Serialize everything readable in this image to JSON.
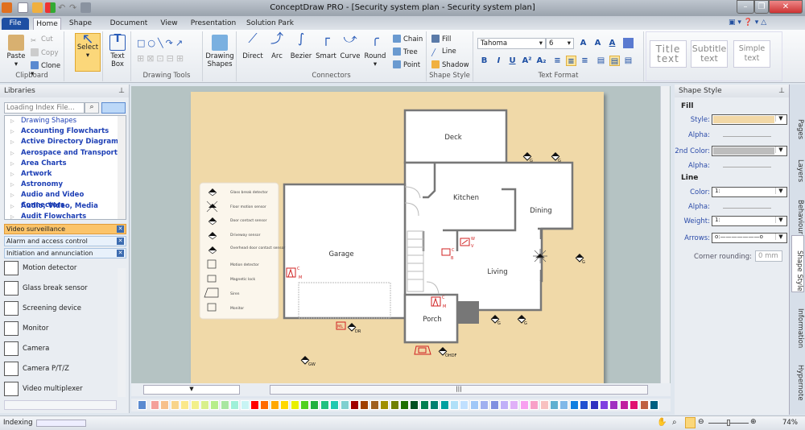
{
  "window": {
    "title": "ConceptDraw PRO - [Security system plan - Security system plan]"
  },
  "tabs": [
    "File",
    "Home",
    "Shape",
    "Document",
    "View",
    "Presentation",
    "Solution Park"
  ],
  "ribbon": {
    "clipboard": {
      "paste": "Paste",
      "cut": "Cut",
      "copy": "Copy",
      "clone": "Clone",
      "label": "Clipboard"
    },
    "select": "Select",
    "textbox": "Text Box",
    "drawing_tools": "Drawing Tools",
    "drawing_shapes": "Drawing Shapes",
    "connectors": {
      "items": [
        "Direct",
        "Arc",
        "Bezier",
        "Smart",
        "Curve",
        "Round"
      ],
      "label": "Connectors",
      "chain": "Chain",
      "tree": "Tree",
      "point": "Point"
    },
    "shape_style": {
      "fill": "Fill",
      "line": "Line",
      "shadow": "Shadow",
      "label": "Shape Style"
    },
    "text_format": {
      "font": "Tahoma",
      "size": "6",
      "label": "Text Format"
    },
    "styles": {
      "title": "Title text",
      "subtitle": "Subtitle text",
      "simple": "Simple text"
    }
  },
  "libraries": {
    "title": "Libraries",
    "search_placeholder": "Loading Index File...",
    "tree": [
      "Drawing Shapes",
      "Accounting Flowcharts",
      "Active Directory Diagrams",
      "Aerospace and Transport",
      "Area Charts",
      "Artwork",
      "Astronomy",
      "Audio and Video Connectors",
      "Audio, Video, Media",
      "Audit Flowcharts"
    ],
    "open": [
      "Video surveillance",
      "Alarm and access control",
      "Initiation and annunciation"
    ],
    "shapes": [
      "Motion detector",
      "Glass break sensor",
      "Screening device",
      "Monitor",
      "Camera",
      "Camera P/T/Z",
      "Video multiplexer"
    ]
  },
  "plan": {
    "rooms": {
      "deck": "Deck",
      "kitchen": "Kitchen",
      "dining": "Dining",
      "garage": "Garage",
      "living": "Living",
      "porch": "Porch"
    },
    "legend": [
      "Glass break detector",
      "Floor motion sensor",
      "Door contact sensor",
      "Driveway sensor",
      "Overhead door contact sensor",
      "Motion detector",
      "Magnetic lock",
      "Siren",
      "Monitor"
    ],
    "codes": {
      "g": "G",
      "dr": "DR",
      "gw": "GW",
      "ohdf": "OHDF",
      "c": "C",
      "m": "M",
      "b": "B",
      "w": "W",
      "v": "V",
      "ml": "ML"
    }
  },
  "palette": [
    "#f4a09a",
    "#f7c08a",
    "#f8d48a",
    "#fbe88a",
    "#f2f08a",
    "#d8f08a",
    "#b6ee8a",
    "#a8e6a0",
    "#9ef0d8",
    "#c8f4f4",
    "#ff0000",
    "#ff6a00",
    "#ffa800",
    "#ffd800",
    "#e8f000",
    "#50d020",
    "#20b040",
    "#20c080",
    "#20c8b0",
    "#80d0d0",
    "#a00000",
    "#a04000",
    "#a06020",
    "#a09000",
    "#708000",
    "#207000",
    "#005020",
    "#008050",
    "#008070",
    "#00a0a0",
    "#b0e0f8",
    "#c0e0ff",
    "#a0c8f8",
    "#a0b0f0",
    "#8090e0",
    "#c0b0f8",
    "#e0b0f8",
    "#f8a0f0",
    "#f8a0c8",
    "#f8c0c0",
    "#60b0d0",
    "#80b8e8",
    "#1080e0",
    "#2050d0",
    "#3030c0",
    "#8040e0",
    "#a030c0",
    "#c020a0",
    "#e01070",
    "#c06040",
    "#006080"
  ],
  "status": {
    "indexing": "Indexing",
    "zoom": "74%"
  },
  "shape_style": {
    "title": "Shape Style",
    "fill": "Fill",
    "style": "Style:",
    "alpha": "Alpha:",
    "second_color": "2nd Color:",
    "line": "Line",
    "color": "Color:",
    "weight": "Weight:",
    "arrows": "Arrows:",
    "corner": "Corner rounding:",
    "corner_value": "0 mm",
    "line_value": "1:",
    "fill_color": "#f2d8a6",
    "second_color_value": "#bdbdbd"
  },
  "side_tabs": [
    "Pages",
    "Layers",
    "Behaviour",
    "Shape Style",
    "Information",
    "Hypernote"
  ]
}
